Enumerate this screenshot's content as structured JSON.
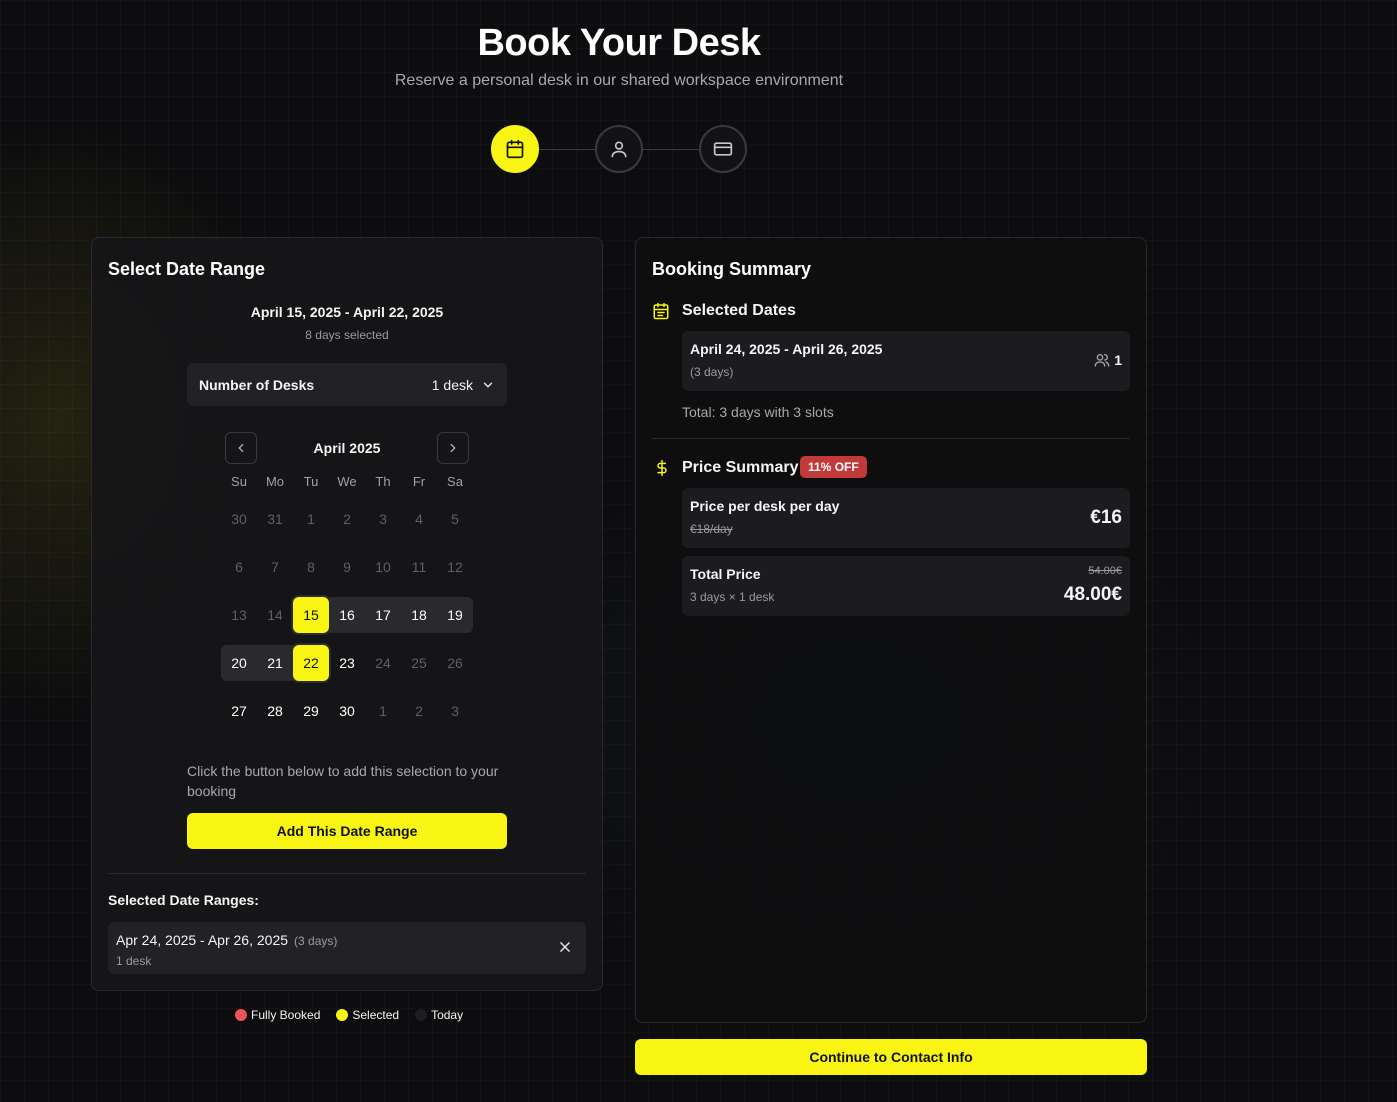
{
  "header": {
    "title": "Book Your Desk",
    "subtitle": "Reserve a personal desk in our shared workspace environment"
  },
  "stepper": {
    "steps": [
      {
        "icon": "calendar-icon",
        "active": true
      },
      {
        "icon": "user-icon",
        "active": false
      },
      {
        "icon": "credit-card-icon",
        "active": false
      }
    ]
  },
  "left_panel": {
    "title": "Select Date Range",
    "range_title": "April 15, 2025 - April 22, 2025",
    "range_subtitle": "8 days selected",
    "desks": {
      "label": "Number of Desks",
      "value": "1 desk"
    },
    "calendar": {
      "month": "April 2025",
      "weekdays": [
        "Su",
        "Mo",
        "Tu",
        "We",
        "Th",
        "Fr",
        "Sa"
      ],
      "weeks": [
        [
          "30",
          "31",
          "1",
          "2",
          "3",
          "4",
          "5"
        ],
        [
          "6",
          "7",
          "8",
          "9",
          "10",
          "11",
          "12"
        ],
        [
          "13",
          "14",
          "15",
          "16",
          "17",
          "18",
          "19"
        ],
        [
          "20",
          "21",
          "22",
          "23",
          "24",
          "25",
          "26"
        ],
        [
          "27",
          "28",
          "29",
          "30",
          "1",
          "2",
          "3"
        ]
      ]
    },
    "hint": "Click the button below to add this selection to your booking",
    "add_button": "Add This Date Range",
    "ranges_label": "Selected Date Ranges:",
    "ranges": [
      {
        "dates": "Apr 24, 2025 - Apr 26, 2025",
        "days": "(3 days)",
        "desks": "1 desk"
      }
    ]
  },
  "legend": {
    "fully_booked": "Fully Booked",
    "selected": "Selected",
    "today": "Today"
  },
  "right_panel": {
    "title": "Booking Summary",
    "selected_dates": {
      "title": "Selected Dates",
      "dates": "April 24, 2025 - April 26, 2025",
      "days": "(3 days)",
      "people": "1",
      "total": "Total: 3 days with 3 slots"
    },
    "price": {
      "title": "Price Summary",
      "badge": "11% OFF",
      "per_day_label": "Price per desk per day",
      "per_day_old": "€18/day",
      "per_day_new": "€16",
      "total_label": "Total Price",
      "total_sub": "3 days × 1 desk",
      "total_old": "54.00€",
      "total_new": "48.00€"
    }
  },
  "continue_button": "Continue to Contact Info",
  "colors": {
    "accent": "#f8f514",
    "danger": "#c2393b",
    "booked_dot": "#f0545b",
    "background": "#0d0d0f"
  }
}
